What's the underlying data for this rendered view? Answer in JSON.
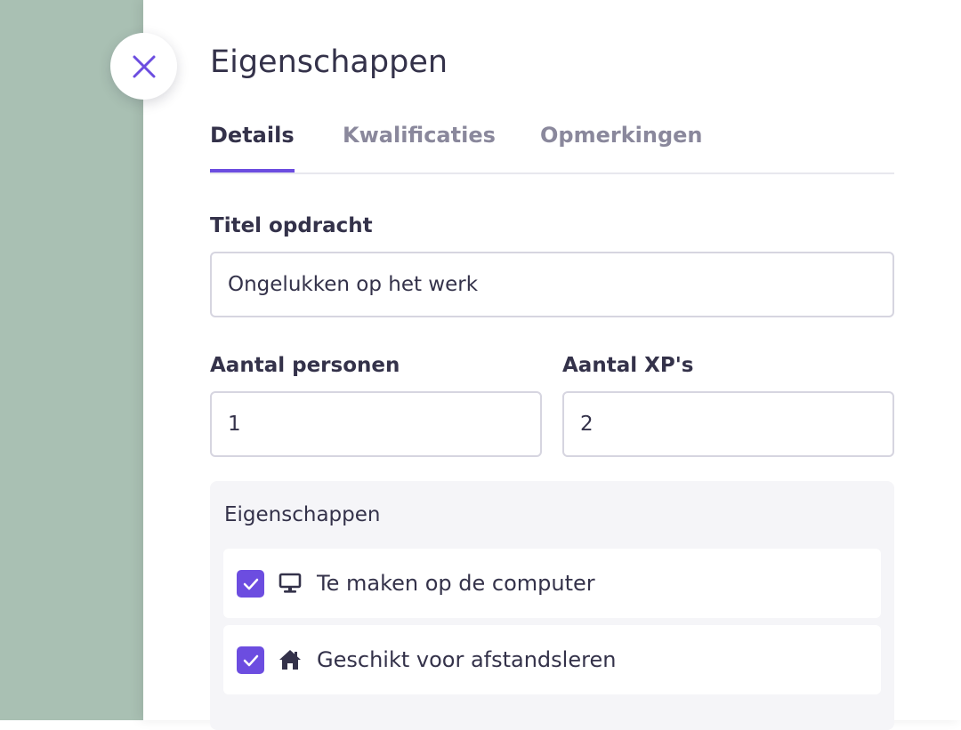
{
  "panel": {
    "title": "Eigenschappen"
  },
  "tabs": [
    {
      "label": "Details",
      "active": true
    },
    {
      "label": "Kwalificaties",
      "active": false
    },
    {
      "label": "Opmerkingen",
      "active": false
    }
  ],
  "form": {
    "title_field": {
      "label": "Titel opdracht",
      "value": "Ongelukken op het werk"
    },
    "persons_field": {
      "label": "Aantal personen",
      "value": "1"
    },
    "xp_field": {
      "label": "Aantal XP's",
      "value": "2"
    }
  },
  "properties": {
    "title": "Eigenschappen",
    "items": [
      {
        "label": "Te maken op de computer",
        "checked": true,
        "icon": "monitor-icon"
      },
      {
        "label": "Geschikt voor afstandsleren",
        "checked": true,
        "icon": "home-icon"
      }
    ]
  },
  "colors": {
    "accent": "#6c4de0",
    "backdrop": "#a9c0b3",
    "text": "#34324a",
    "muted": "#8a889c"
  }
}
